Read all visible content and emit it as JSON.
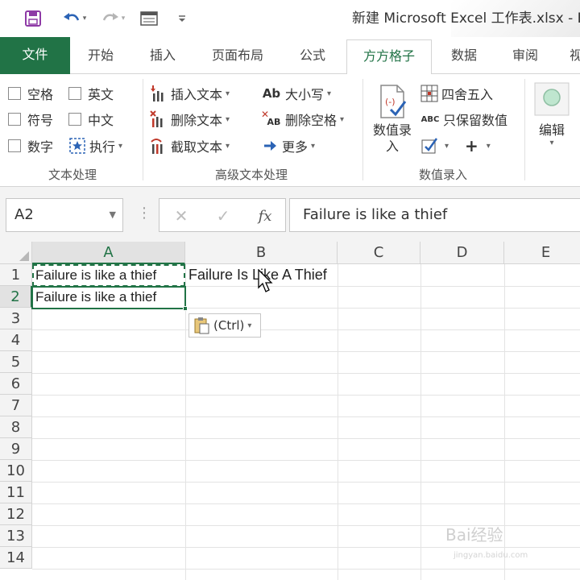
{
  "title": "新建 Microsoft Excel 工作表.xlsx - E",
  "quick_access": [
    "save-icon",
    "undo-icon",
    "redo-icon",
    "form-icon",
    "customize-icon"
  ],
  "tabs": [
    "文件",
    "开始",
    "插入",
    "页面布局",
    "公式",
    "方方格子",
    "数据",
    "审阅",
    "视"
  ],
  "active_tab": "方方格子",
  "ribbon": {
    "group_text": {
      "label": "文本处理",
      "checks": [
        "空格",
        "英文",
        "符号",
        "中文",
        "数字"
      ],
      "execute": "执行"
    },
    "group_adv": {
      "label": "高级文本处理",
      "insert": "插入文本",
      "delete": "删除文本",
      "extract": "截取文本",
      "case": "大小写",
      "delspace": "删除空格",
      "more": "更多",
      "ab_glyph": "Ab",
      "ab_small": "AB"
    },
    "group_num": {
      "label": "数值录入",
      "entry": "数值录\n入",
      "round": "四舍五入",
      "keep": "只保留数值",
      "abc": "ABC",
      "plus": "+"
    },
    "group_edit": {
      "label": "编辑"
    }
  },
  "formula_bar": {
    "name_box": "A2",
    "fx": "fx",
    "content": "Failure is like a thief"
  },
  "grid": {
    "columns": [
      "A",
      "B",
      "C",
      "D",
      "E"
    ],
    "rows": [
      "1",
      "2",
      "3",
      "4",
      "5",
      "6",
      "7",
      "8",
      "9",
      "10",
      "11",
      "12",
      "13",
      "14"
    ],
    "cells": {
      "A1": "Failure is like a thief",
      "A2": "Failure is like a thief",
      "B1": "Failure Is Like A Thief"
    },
    "selected_cell": "A2",
    "paste_options": "(Ctrl)"
  },
  "watermark": {
    "text": "Bai经验",
    "url": "jingyan.baidu.com"
  },
  "colors": {
    "accent": "#217346",
    "grid_line": "#e3e3e3",
    "header_bg": "#f3f3f3"
  }
}
